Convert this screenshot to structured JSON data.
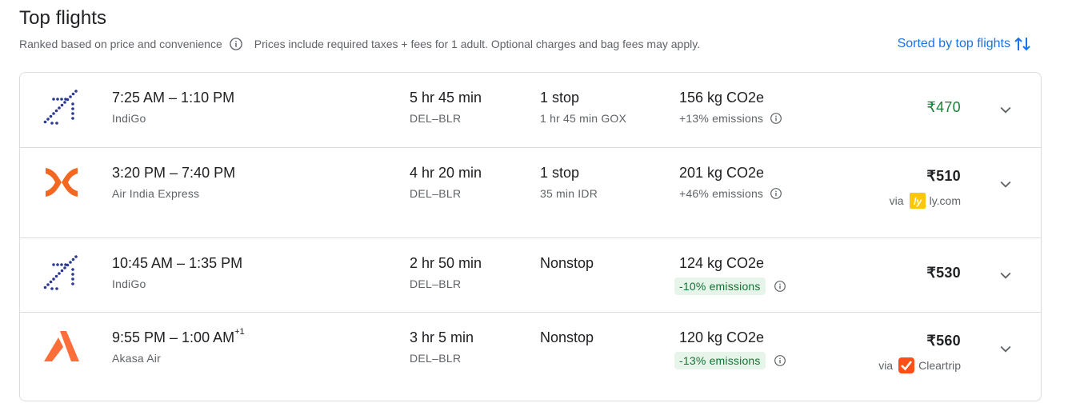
{
  "header": {
    "title": "Top flights",
    "ranking_note": "Ranked based on price and convenience",
    "price_note": "Prices include required taxes + fees for 1 adult. Optional charges and bag fees may apply.",
    "sort_label": "Sorted by top flights"
  },
  "colors": {
    "accent": "#1a73e8",
    "deal_price": "#188038",
    "emission_badge_bg": "#e6f4ea",
    "emission_badge_text": "#137333"
  },
  "flights": [
    {
      "times": "7:25 AM – 1:10 PM",
      "day_offset": "",
      "airline": "IndiGo",
      "logo": "indigo-logo",
      "duration": "5 hr 45 min",
      "route": "DEL–BLR",
      "stops": "1 stop",
      "stop_detail": "1 hr 45 min GOX",
      "co2": "156 kg CO2e",
      "emissions": "+13% emissions",
      "price": "₹470",
      "via_label": "",
      "via_site": ""
    },
    {
      "times": "3:20 PM – 7:40 PM",
      "day_offset": "",
      "airline": "Air India Express",
      "logo": "air-india-express-logo",
      "duration": "4 hr 20 min",
      "route": "DEL–BLR",
      "stops": "1 stop",
      "stop_detail": "35 min IDR",
      "co2": "201 kg CO2e",
      "emissions": "+46% emissions",
      "price": "₹510",
      "via_label": "via",
      "via_site": "ly.com"
    },
    {
      "times": "10:45 AM – 1:35 PM",
      "day_offset": "",
      "airline": "IndiGo",
      "logo": "indigo-logo",
      "duration": "2 hr 50 min",
      "route": "DEL–BLR",
      "stops": "Nonstop",
      "stop_detail": "",
      "co2": "124 kg CO2e",
      "emissions": "-10% emissions",
      "price": "₹530",
      "via_label": "",
      "via_site": ""
    },
    {
      "times": "9:55 PM – 1:00 AM",
      "day_offset": "+1",
      "airline": "Akasa Air",
      "logo": "akasa-air-logo",
      "duration": "3 hr 5 min",
      "route": "DEL–BLR",
      "stops": "Nonstop",
      "stop_detail": "",
      "co2": "120 kg CO2e",
      "emissions": "-13% emissions",
      "price": "₹560",
      "via_label": "via",
      "via_site": "Cleartrip"
    }
  ]
}
